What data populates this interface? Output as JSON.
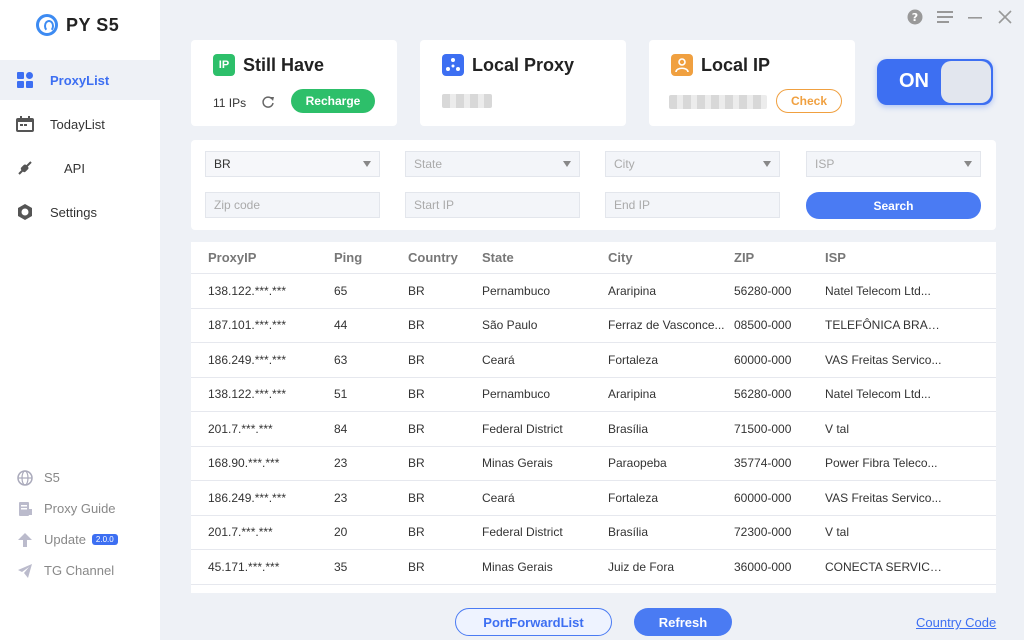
{
  "app": {
    "title": "PY S5"
  },
  "sidebar": {
    "items": [
      {
        "label": "ProxyList",
        "icon": "grid-icon",
        "active": true
      },
      {
        "label": "TodayList",
        "icon": "calendar-icon"
      },
      {
        "label": "API",
        "icon": "plug-icon"
      },
      {
        "label": "Settings",
        "icon": "gear-icon"
      }
    ],
    "bottom": [
      {
        "label": "S5",
        "icon": "globe-icon"
      },
      {
        "label": "Proxy Guide",
        "icon": "book-icon"
      },
      {
        "label": "Update",
        "icon": "upload-icon",
        "badge": "2.0.0"
      },
      {
        "label": "TG Channel",
        "icon": "telegram-icon"
      }
    ]
  },
  "cards": {
    "still_have": {
      "title": "Still Have",
      "icon_text": "IP",
      "count": "11 IPs",
      "button": "Recharge"
    },
    "local_proxy": {
      "title": "Local Proxy"
    },
    "local_ip": {
      "title": "Local IP",
      "button": "Check"
    },
    "toggle": {
      "label": "ON"
    }
  },
  "filters": {
    "country": "BR",
    "state_placeholder": "State",
    "city_placeholder": "City",
    "isp_placeholder": "ISP",
    "zip_placeholder": "Zip code",
    "start_ip_placeholder": "Start IP",
    "end_ip_placeholder": "End IP",
    "search_label": "Search"
  },
  "table": {
    "headers": [
      "ProxyIP",
      "Ping",
      "Country",
      "State",
      "City",
      "ZIP",
      "ISP"
    ],
    "rows": [
      [
        "138.122.***.***",
        "65",
        "BR",
        "Pernambuco",
        "Araripina",
        "56280-000",
        "Natel Telecom Ltd..."
      ],
      [
        "187.101.***.***",
        "44",
        "BR",
        "São Paulo",
        "Ferraz de Vasconce...",
        "08500-000",
        "TELEFÔNICA BRASI..."
      ],
      [
        "186.249.***.***",
        "63",
        "BR",
        "Ceará",
        "Fortaleza",
        "60000-000",
        "VAS Freitas Servico..."
      ],
      [
        "138.122.***.***",
        "51",
        "BR",
        "Pernambuco",
        "Araripina",
        "56280-000",
        "Natel Telecom Ltd..."
      ],
      [
        "201.7.***.***",
        "84",
        "BR",
        "Federal District",
        "Brasília",
        "71500-000",
        "V tal"
      ],
      [
        "168.90.***.***",
        "23",
        "BR",
        "Minas Gerais",
        "Paraopeba",
        "35774-000",
        "Power Fibra Teleco..."
      ],
      [
        "186.249.***.***",
        "23",
        "BR",
        "Ceará",
        "Fortaleza",
        "60000-000",
        "VAS Freitas Servico..."
      ],
      [
        "201.7.***.***",
        "20",
        "BR",
        "Federal District",
        "Brasília",
        "72300-000",
        "V tal"
      ],
      [
        "45.171.***.***",
        "35",
        "BR",
        "Minas Gerais",
        "Juiz de Fora",
        "36000-000",
        "CONECTA SERVICO..."
      ]
    ]
  },
  "footer": {
    "port_forward": "PortForwardList",
    "refresh": "Refresh",
    "country_code": "Country Code"
  },
  "colors": {
    "accent": "#3d6ff2",
    "green": "#2dbf6a",
    "orange": "#f0a040"
  }
}
